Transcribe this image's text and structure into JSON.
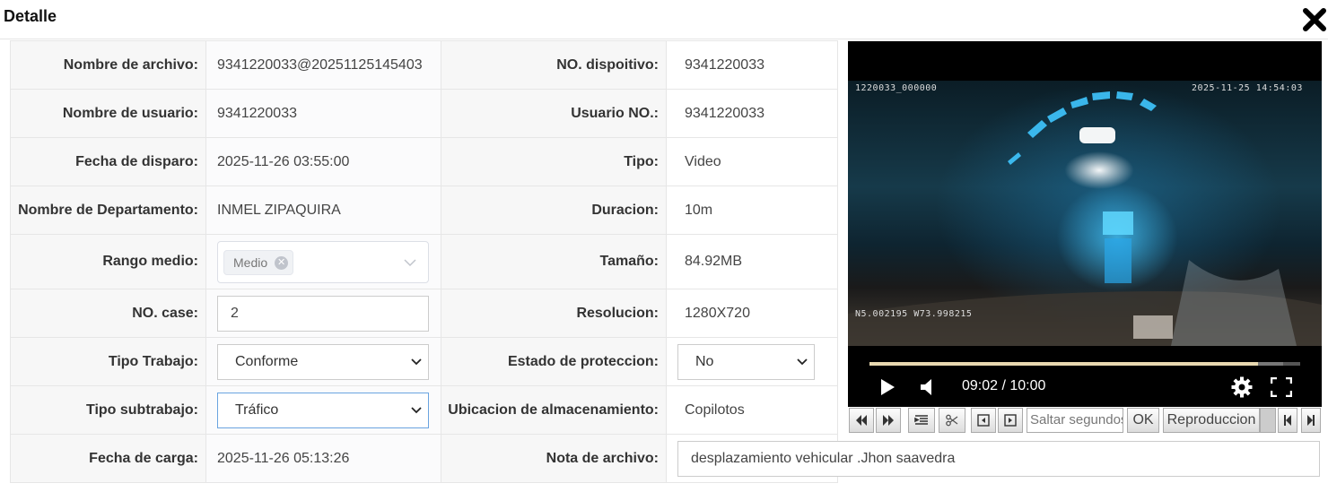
{
  "dialog": {
    "title": "Detalle"
  },
  "rows": [
    {
      "l_label": "Nombre de archivo:",
      "l_value": "9341220033@20251125145403",
      "r_label": "NO. dispoitivo:",
      "r_value": "9341220033"
    },
    {
      "l_label": "Nombre de usuario:",
      "l_value": "9341220033",
      "r_label": "Usuario NO.:",
      "r_value": "9341220033"
    },
    {
      "l_label": "Fecha de disparo:",
      "l_value": "2025-11-26 03:55:00",
      "r_label": "Tipo:",
      "r_value": "Video"
    },
    {
      "l_label": "Nombre de Departamento:",
      "l_value": "INMEL ZIPAQUIRA",
      "r_label": "Duracion:",
      "r_value": "10m"
    },
    {
      "l_label": "Rango medio:",
      "l_tag": "Medio",
      "r_label": "Tamaño:",
      "r_value": "84.92MB"
    },
    {
      "l_label": "NO. case:",
      "l_input": "2",
      "r_label": "Resolucion:",
      "r_value": "1280X720"
    },
    {
      "l_label": "Tipo Trabajo:",
      "l_select": "Conforme",
      "r_label": "Estado de proteccion:",
      "r_select": "No"
    },
    {
      "l_label": "Tipo subtrabajo:",
      "l_select": "Tráfico",
      "r_label": "Ubicacion de almacenamiento:",
      "r_value": "Copilotos"
    },
    {
      "l_label": "Fecha de carga:",
      "l_value": "2025-11-26 05:13:26",
      "r_label": "Nota de archivo:",
      "r_input": "desplazamiento vehicular .Jhon saavedra"
    }
  ],
  "video": {
    "osd_top_left": "1220033_000000",
    "osd_top_right": "2025-11-25 14:54:03",
    "osd_bottom_left": "N5.002195 W73.998215",
    "time": "09:02 / 10:00",
    "progress": 0.903,
    "buffered": 0.96
  },
  "toolbar": {
    "seek_placeholder": "Saltar segundos",
    "ok_label": "OK",
    "playback_label": "Reproduccion"
  },
  "icons": [
    "close-icon",
    "chevron-down-icon",
    "tag-close-icon",
    "play-icon",
    "volume-icon",
    "gear-icon",
    "fullscreen-icon",
    "rewind-icon",
    "fast-forward-icon",
    "list-icon",
    "scissors-icon",
    "frame-back-icon",
    "frame-forward-icon",
    "skip-start-icon",
    "skip-end-icon"
  ]
}
